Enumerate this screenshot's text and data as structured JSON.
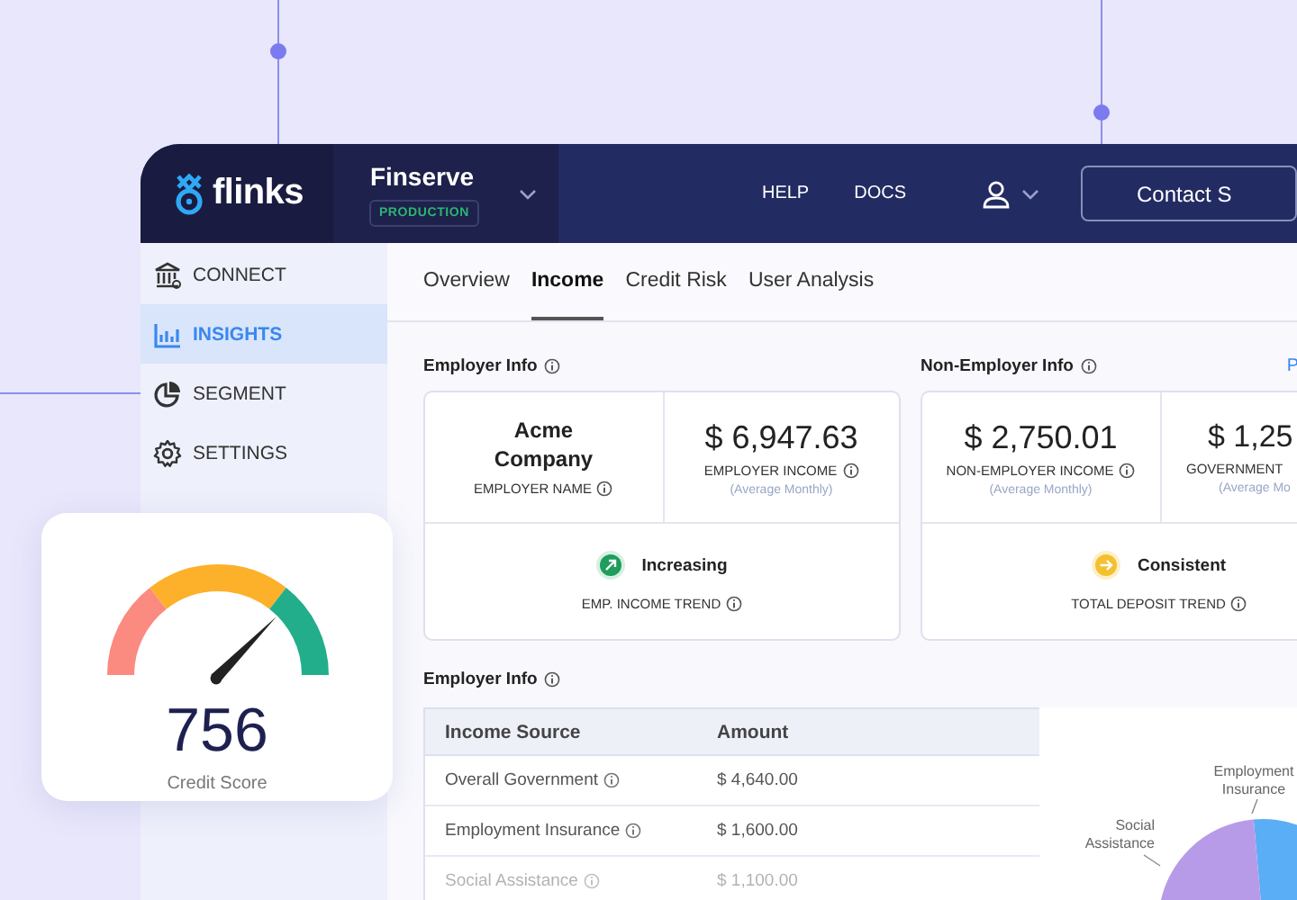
{
  "brand": {
    "name": "flinks"
  },
  "workspace": {
    "name": "Finserve",
    "badge": "PRODUCTION"
  },
  "nav": {
    "links": [
      "HELP",
      "DOCS"
    ],
    "button": "Contact S"
  },
  "sidebar": {
    "items": [
      {
        "label": "CONNECT",
        "kind": "bank",
        "selected": false
      },
      {
        "label": "INSIGHTS",
        "kind": "chart",
        "selected": true
      },
      {
        "label": "SEGMENT",
        "kind": "pie",
        "selected": false
      },
      {
        "label": "SETTINGS",
        "kind": "gear",
        "selected": false
      }
    ]
  },
  "tabs": [
    {
      "label": "Overview",
      "selected": false
    },
    {
      "label": "Income",
      "selected": true
    },
    {
      "label": "Credit Risk",
      "selected": false
    },
    {
      "label": "User Analysis",
      "selected": false
    }
  ],
  "employer_info": {
    "title": "Employer Info",
    "name": "Acme Company",
    "name_label": "EMPLOYER NAME",
    "income": "$ 6,947.63",
    "income_label": "EMPLOYER INCOME",
    "income_note": "(Average Monthly)",
    "trend": {
      "kind": "increasing",
      "value": "Increasing",
      "label": "EMP. INCOME TREND"
    }
  },
  "non_employer_info": {
    "title": "Non-Employer Info",
    "link": "P",
    "metrics": [
      {
        "value": "$ 2,750.01",
        "label": "NON-EMPLOYER INCOME",
        "note": "(Average Monthly)",
        "info": true
      },
      {
        "value": "$ 1,25",
        "label": "GOVERNMENT",
        "note": "(Average Mo",
        "info": false
      }
    ],
    "trend": {
      "kind": "consistent",
      "value": "Consistent",
      "label": "TOTAL DEPOSIT TREND"
    }
  },
  "income_table": {
    "title": "Employer Info",
    "columns": [
      "Income Source",
      "Amount"
    ],
    "rows": [
      {
        "source": "Overall Government",
        "amount": "$ 4,640.00"
      },
      {
        "source": "Employment Insurance",
        "amount": "$ 1,600.00"
      },
      {
        "source": "Social Assistance",
        "amount": "$ 1,100.00"
      }
    ]
  },
  "pie": {
    "labels": [
      "Employment Insurance",
      "Social Assistance"
    ]
  },
  "credit_score": {
    "value": "756",
    "label": "Credit Score"
  }
}
